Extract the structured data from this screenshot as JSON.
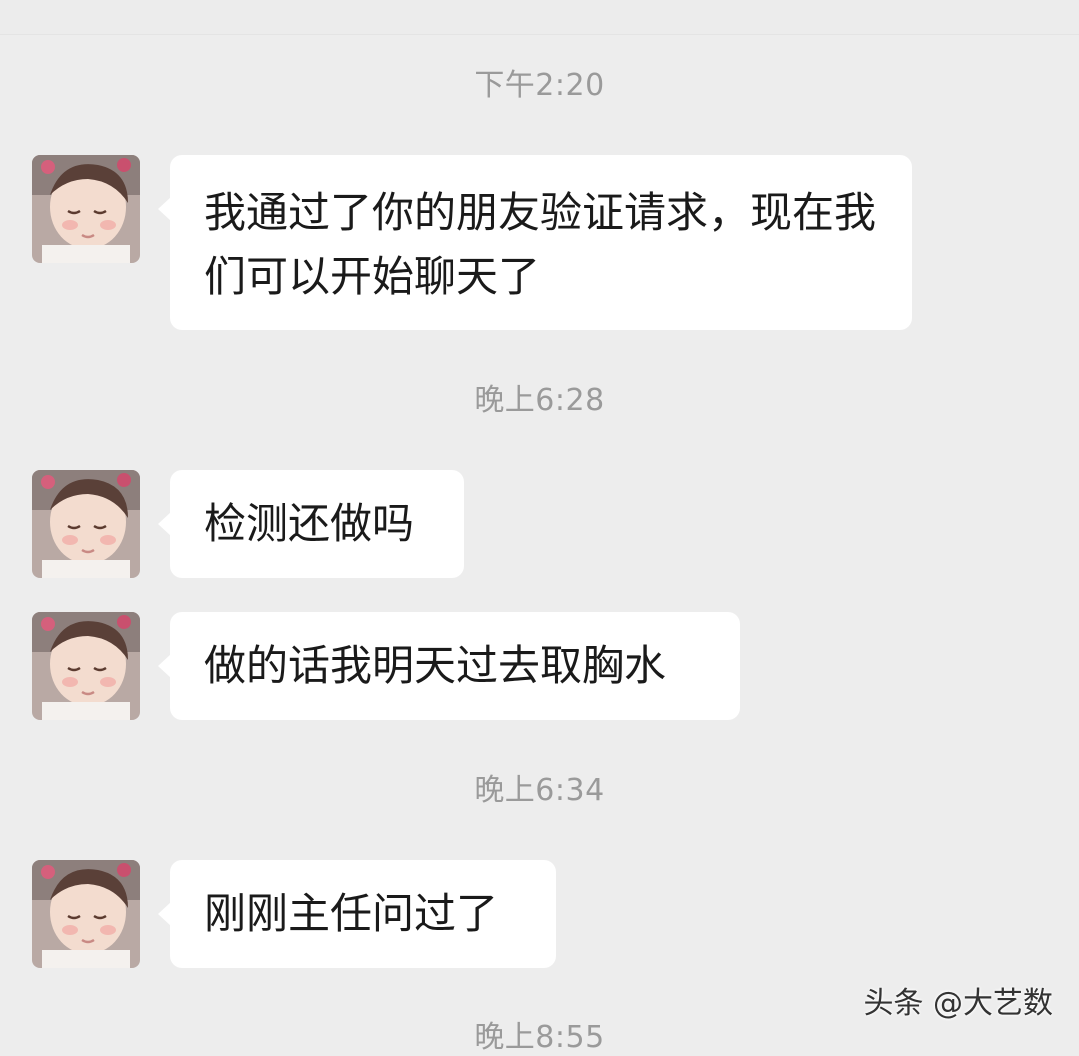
{
  "chat": {
    "timestamps": [
      "下午2:20",
      "晚上6:28",
      "晚上6:34",
      "晚上8:55"
    ],
    "messages": [
      {
        "text": "我通过了你的朋友验证请求，现在我们可以开始聊天了",
        "avatar_icon": "baby-avatar-icon"
      },
      {
        "text": "检测还做吗",
        "avatar_icon": "baby-avatar-icon"
      },
      {
        "text": "做的话我明天过去取胸水",
        "avatar_icon": "baby-avatar-icon"
      },
      {
        "text": "刚刚主任问过了",
        "avatar_icon": "baby-avatar-icon"
      }
    ]
  },
  "watermark": "头条 @大艺数",
  "colors": {
    "background": "#ededed",
    "bubble": "#ffffff",
    "timestamp": "#9a9a9a",
    "text": "#1a1a1a"
  }
}
